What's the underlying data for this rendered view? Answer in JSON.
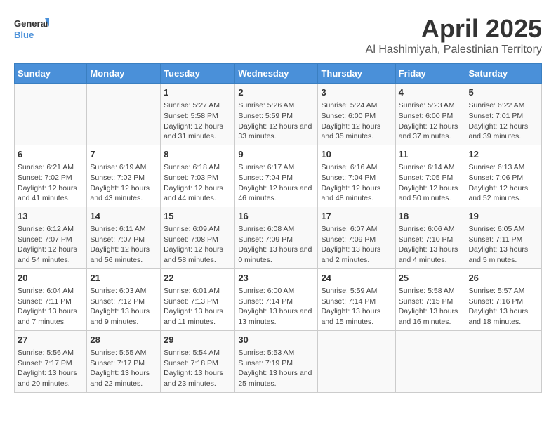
{
  "logo": {
    "line1": "General",
    "line2": "Blue"
  },
  "title": "April 2025",
  "subtitle": "Al Hashimiyah, Palestinian Territory",
  "days_of_week": [
    "Sunday",
    "Monday",
    "Tuesday",
    "Wednesday",
    "Thursday",
    "Friday",
    "Saturday"
  ],
  "weeks": [
    [
      {
        "day": "",
        "content": ""
      },
      {
        "day": "",
        "content": ""
      },
      {
        "day": "1",
        "content": "Sunrise: 5:27 AM\nSunset: 5:58 PM\nDaylight: 12 hours and 31 minutes."
      },
      {
        "day": "2",
        "content": "Sunrise: 5:26 AM\nSunset: 5:59 PM\nDaylight: 12 hours and 33 minutes."
      },
      {
        "day": "3",
        "content": "Sunrise: 5:24 AM\nSunset: 6:00 PM\nDaylight: 12 hours and 35 minutes."
      },
      {
        "day": "4",
        "content": "Sunrise: 5:23 AM\nSunset: 6:00 PM\nDaylight: 12 hours and 37 minutes."
      },
      {
        "day": "5",
        "content": "Sunrise: 6:22 AM\nSunset: 7:01 PM\nDaylight: 12 hours and 39 minutes."
      }
    ],
    [
      {
        "day": "6",
        "content": "Sunrise: 6:21 AM\nSunset: 7:02 PM\nDaylight: 12 hours and 41 minutes."
      },
      {
        "day": "7",
        "content": "Sunrise: 6:19 AM\nSunset: 7:02 PM\nDaylight: 12 hours and 43 minutes."
      },
      {
        "day": "8",
        "content": "Sunrise: 6:18 AM\nSunset: 7:03 PM\nDaylight: 12 hours and 44 minutes."
      },
      {
        "day": "9",
        "content": "Sunrise: 6:17 AM\nSunset: 7:04 PM\nDaylight: 12 hours and 46 minutes."
      },
      {
        "day": "10",
        "content": "Sunrise: 6:16 AM\nSunset: 7:04 PM\nDaylight: 12 hours and 48 minutes."
      },
      {
        "day": "11",
        "content": "Sunrise: 6:14 AM\nSunset: 7:05 PM\nDaylight: 12 hours and 50 minutes."
      },
      {
        "day": "12",
        "content": "Sunrise: 6:13 AM\nSunset: 7:06 PM\nDaylight: 12 hours and 52 minutes."
      }
    ],
    [
      {
        "day": "13",
        "content": "Sunrise: 6:12 AM\nSunset: 7:07 PM\nDaylight: 12 hours and 54 minutes."
      },
      {
        "day": "14",
        "content": "Sunrise: 6:11 AM\nSunset: 7:07 PM\nDaylight: 12 hours and 56 minutes."
      },
      {
        "day": "15",
        "content": "Sunrise: 6:09 AM\nSunset: 7:08 PM\nDaylight: 12 hours and 58 minutes."
      },
      {
        "day": "16",
        "content": "Sunrise: 6:08 AM\nSunset: 7:09 PM\nDaylight: 13 hours and 0 minutes."
      },
      {
        "day": "17",
        "content": "Sunrise: 6:07 AM\nSunset: 7:09 PM\nDaylight: 13 hours and 2 minutes."
      },
      {
        "day": "18",
        "content": "Sunrise: 6:06 AM\nSunset: 7:10 PM\nDaylight: 13 hours and 4 minutes."
      },
      {
        "day": "19",
        "content": "Sunrise: 6:05 AM\nSunset: 7:11 PM\nDaylight: 13 hours and 5 minutes."
      }
    ],
    [
      {
        "day": "20",
        "content": "Sunrise: 6:04 AM\nSunset: 7:11 PM\nDaylight: 13 hours and 7 minutes."
      },
      {
        "day": "21",
        "content": "Sunrise: 6:03 AM\nSunset: 7:12 PM\nDaylight: 13 hours and 9 minutes."
      },
      {
        "day": "22",
        "content": "Sunrise: 6:01 AM\nSunset: 7:13 PM\nDaylight: 13 hours and 11 minutes."
      },
      {
        "day": "23",
        "content": "Sunrise: 6:00 AM\nSunset: 7:14 PM\nDaylight: 13 hours and 13 minutes."
      },
      {
        "day": "24",
        "content": "Sunrise: 5:59 AM\nSunset: 7:14 PM\nDaylight: 13 hours and 15 minutes."
      },
      {
        "day": "25",
        "content": "Sunrise: 5:58 AM\nSunset: 7:15 PM\nDaylight: 13 hours and 16 minutes."
      },
      {
        "day": "26",
        "content": "Sunrise: 5:57 AM\nSunset: 7:16 PM\nDaylight: 13 hours and 18 minutes."
      }
    ],
    [
      {
        "day": "27",
        "content": "Sunrise: 5:56 AM\nSunset: 7:17 PM\nDaylight: 13 hours and 20 minutes."
      },
      {
        "day": "28",
        "content": "Sunrise: 5:55 AM\nSunset: 7:17 PM\nDaylight: 13 hours and 22 minutes."
      },
      {
        "day": "29",
        "content": "Sunrise: 5:54 AM\nSunset: 7:18 PM\nDaylight: 13 hours and 23 minutes."
      },
      {
        "day": "30",
        "content": "Sunrise: 5:53 AM\nSunset: 7:19 PM\nDaylight: 13 hours and 25 minutes."
      },
      {
        "day": "",
        "content": ""
      },
      {
        "day": "",
        "content": ""
      },
      {
        "day": "",
        "content": ""
      }
    ]
  ]
}
